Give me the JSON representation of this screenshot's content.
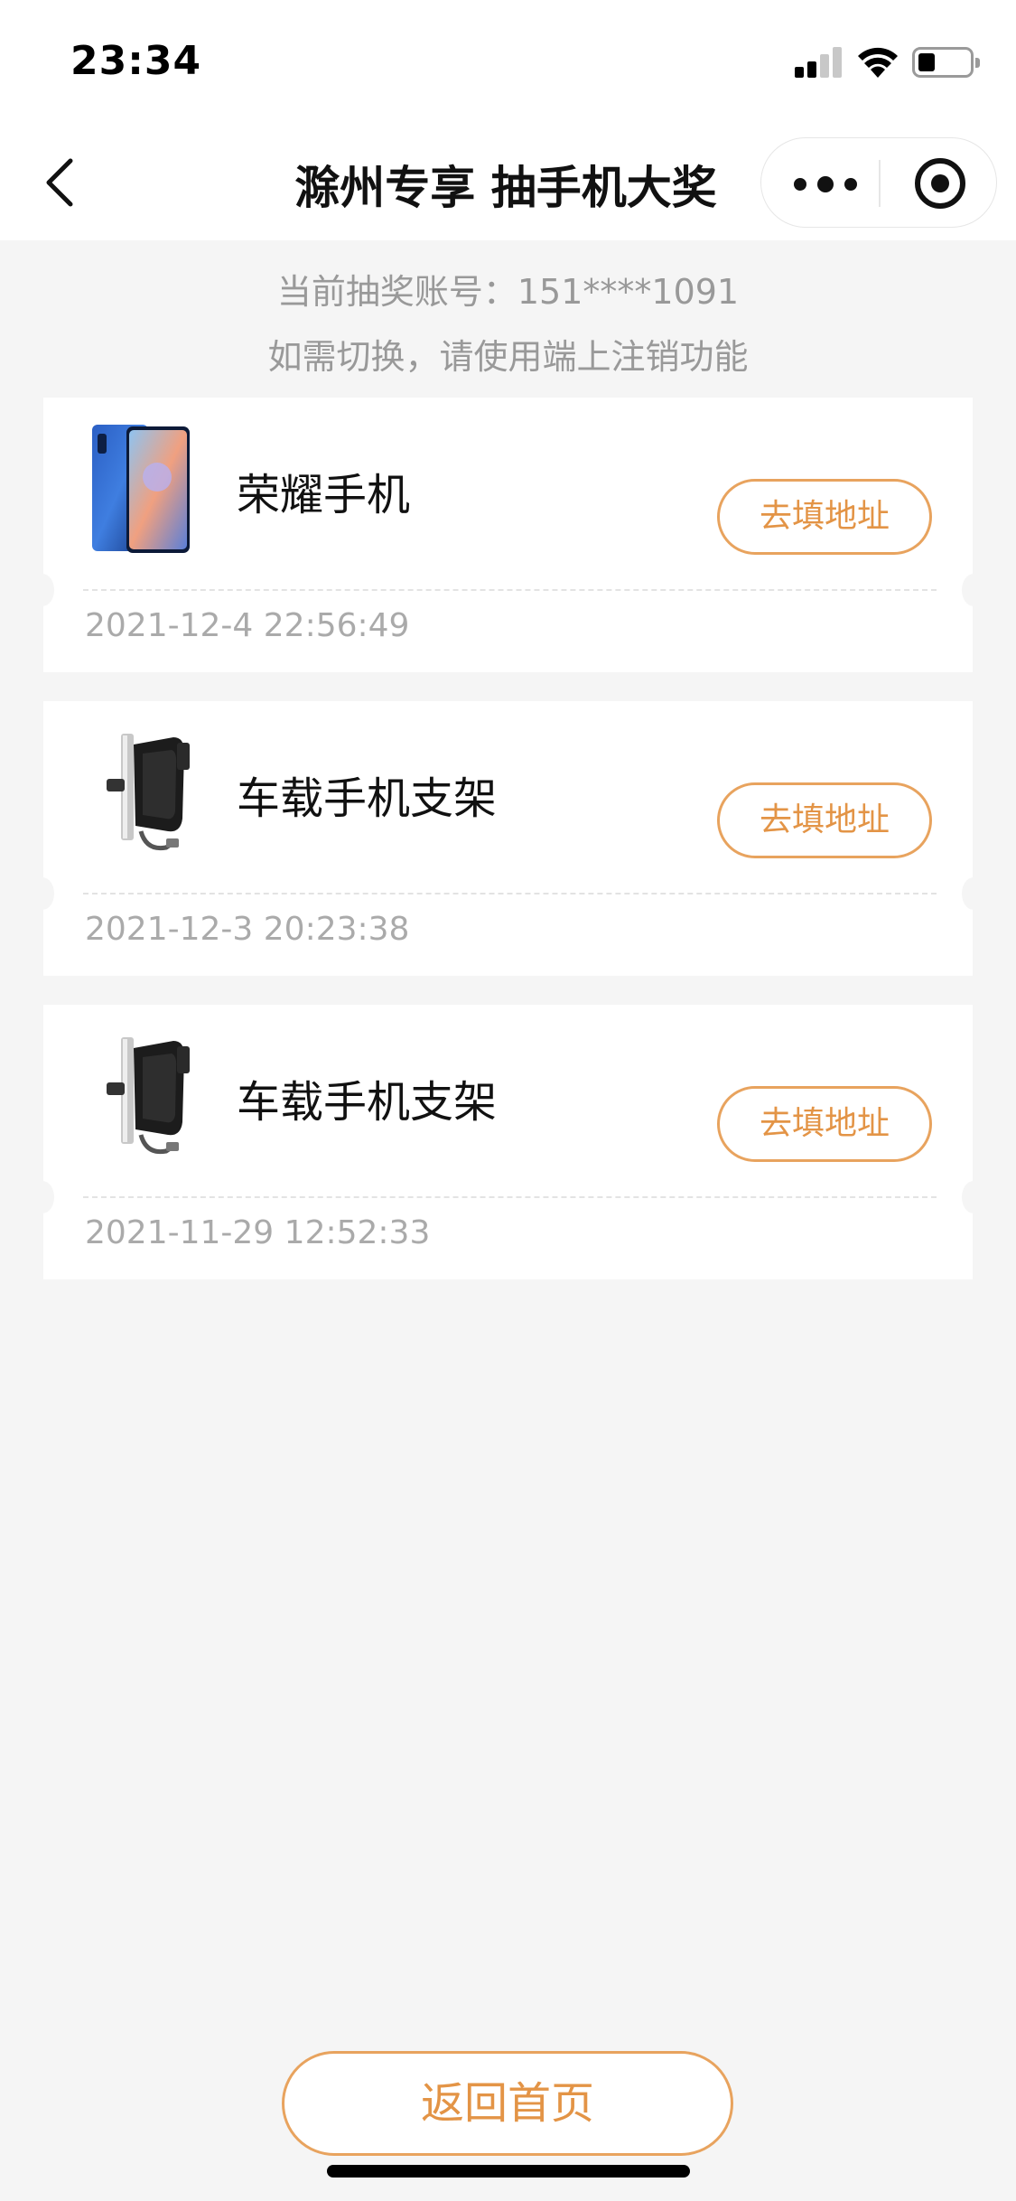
{
  "status_bar": {
    "time": "23:34"
  },
  "nav": {
    "title": "滁州专享 抽手机大奖"
  },
  "account": {
    "line1": "当前抽奖账号：151****1091",
    "line2": "如需切换，请使用端上注销功能"
  },
  "prizes": [
    {
      "name": "荣耀手机",
      "button_label": "去填地址",
      "date": "2021-12-4 22:56:49",
      "thumb_icon": "phone-image"
    },
    {
      "name": "车载手机支架",
      "button_label": "去填地址",
      "date": "2021-12-3 20:23:38",
      "thumb_icon": "car-holder-image"
    },
    {
      "name": "车载手机支架",
      "button_label": "去填地址",
      "date": "2021-11-29 12:52:33",
      "thumb_icon": "car-holder-image"
    }
  ],
  "footer": {
    "home_label": "返回首页"
  },
  "colors": {
    "accent": "#e39446",
    "background": "#f5f5f5",
    "muted_text": "#999999"
  }
}
